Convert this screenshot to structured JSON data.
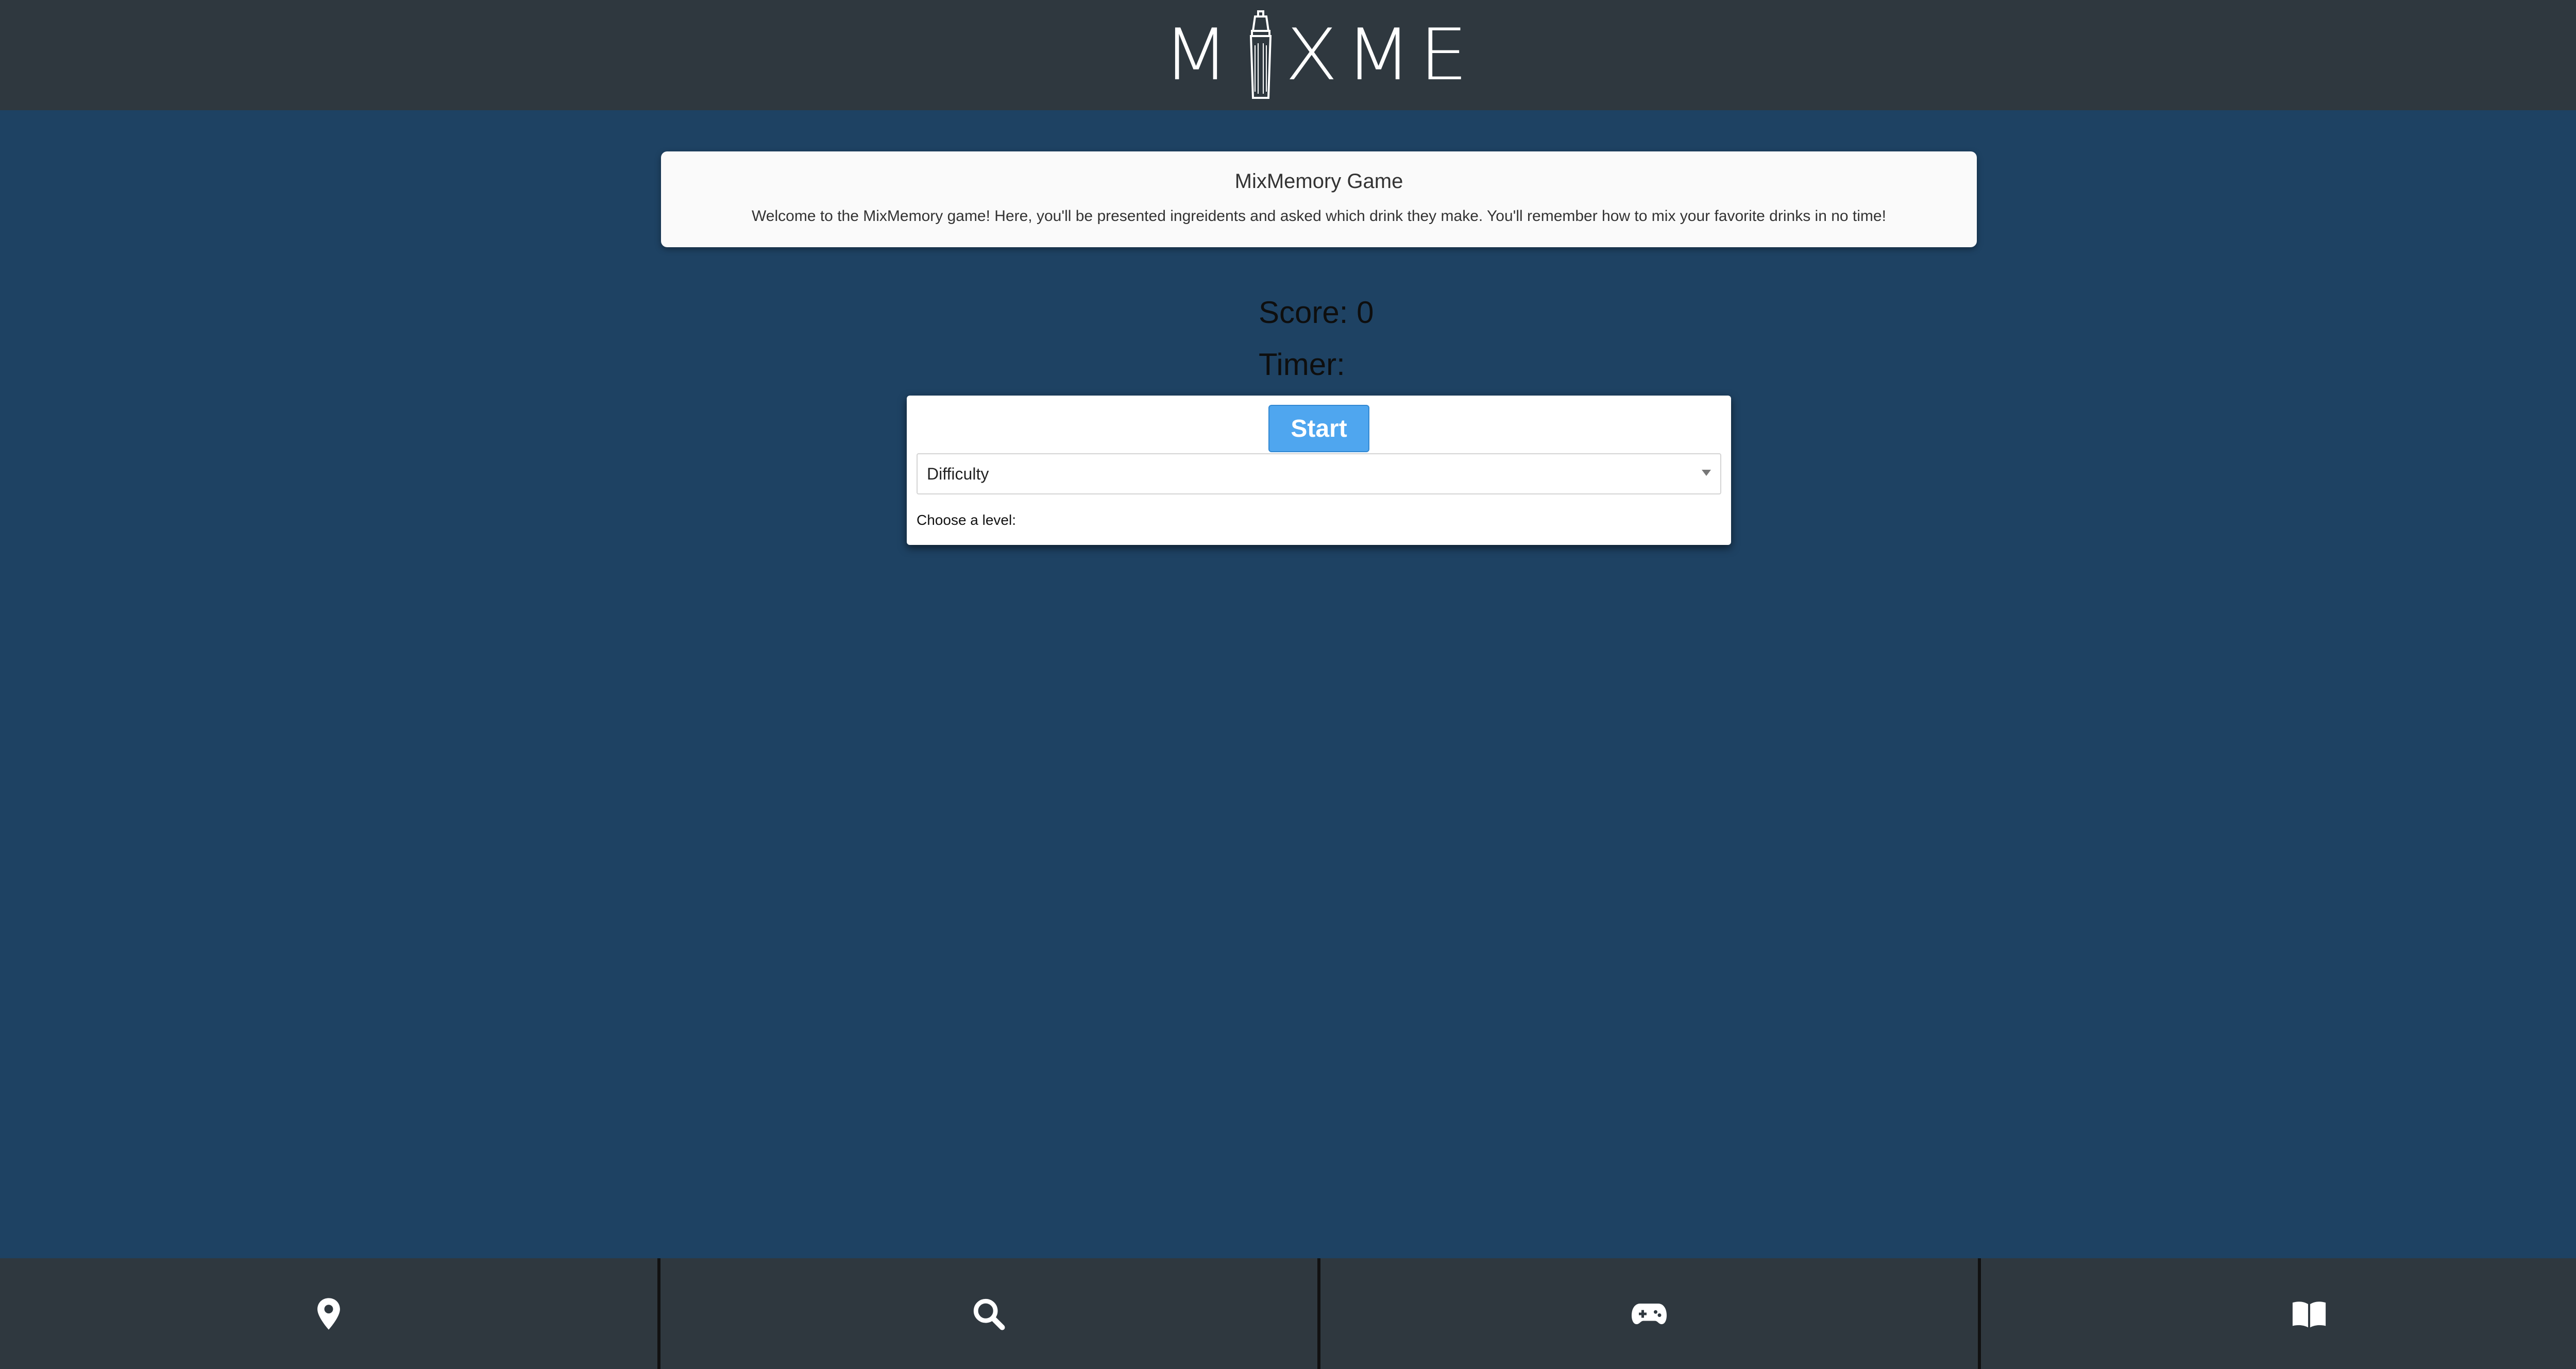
{
  "header": {
    "logo_text_left": "M",
    "logo_text_right": "XME"
  },
  "intro": {
    "title": "MixMemory Game",
    "description": "Welcome to the MixMemory game! Here, you'll be presented ingreidents and asked which drink they make. You'll remember how to mix your favorite drinks in no time!"
  },
  "game": {
    "score_label": "Score: 0",
    "timer_label": "Timer:",
    "start_label": "Start",
    "difficulty_selected": "Difficulty",
    "choose_label": "Choose a level:"
  },
  "nav": {
    "items": [
      {
        "icon": "map-pin-icon"
      },
      {
        "icon": "search-icon"
      },
      {
        "icon": "gamepad-icon"
      },
      {
        "icon": "book-icon"
      }
    ]
  },
  "colors": {
    "background": "#1e4263",
    "header": "#2f383f",
    "accent": "#4fa6ef"
  }
}
